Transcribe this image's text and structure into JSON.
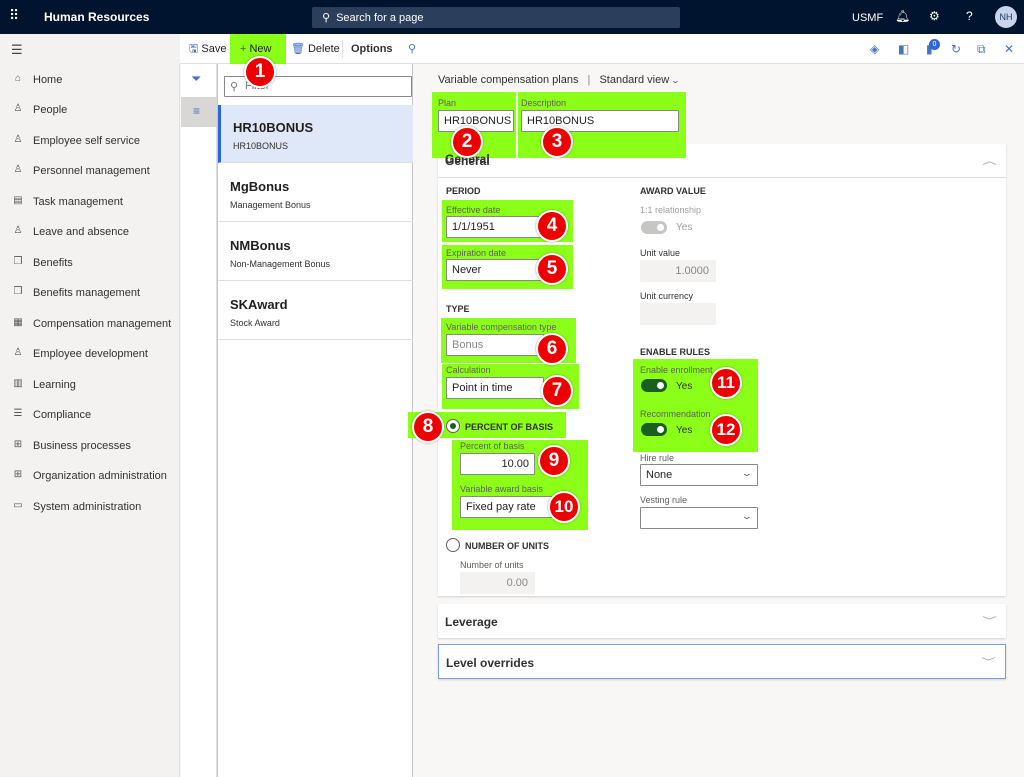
{
  "topbar": {
    "app_title": "Human Resources",
    "search_placeholder": "Search for a page",
    "company": "USMF",
    "user_initials": "NH",
    "icons": [
      "waffle-icon",
      "search-icon",
      "bell-icon",
      "gear-icon",
      "help-icon"
    ]
  },
  "actionbar": {
    "save": "Save",
    "new": "New",
    "delete": "Delete",
    "options": "Options",
    "attachments_count": "0"
  },
  "nav": {
    "items": [
      {
        "label": "Home",
        "icon": "⌂"
      },
      {
        "label": "People",
        "icon": "♙"
      },
      {
        "label": "Employee self service",
        "icon": "♙"
      },
      {
        "label": "Personnel management",
        "icon": "♙"
      },
      {
        "label": "Task management",
        "icon": "▤"
      },
      {
        "label": "Leave and absence",
        "icon": "♙"
      },
      {
        "label": "Benefits",
        "icon": "❒"
      },
      {
        "label": "Benefits management",
        "icon": "❒"
      },
      {
        "label": "Compensation management",
        "icon": "▦"
      },
      {
        "label": "Employee development",
        "icon": "♙"
      },
      {
        "label": "Learning",
        "icon": "▥"
      },
      {
        "label": "Compliance",
        "icon": "☰"
      },
      {
        "label": "Business processes",
        "icon": "⊞"
      },
      {
        "label": "Organization administration",
        "icon": "⊞"
      },
      {
        "label": "System administration",
        "icon": "▭"
      }
    ]
  },
  "list": {
    "filter_placeholder": "Filter",
    "records": [
      {
        "title": "HR10BONUS",
        "subtitle": "HR10BONUS",
        "selected": true
      },
      {
        "title": "MgBonus",
        "subtitle": "Management Bonus"
      },
      {
        "title": "NMBonus",
        "subtitle": "Non-Management Bonus"
      },
      {
        "title": "SKAward",
        "subtitle": "Stock Award"
      }
    ]
  },
  "detail": {
    "breadcrumb": "Variable compensation plans",
    "view": "Standard view",
    "plan_label": "Plan",
    "plan_value": "HR10BONUS",
    "description_label": "Description",
    "description_value": "HR10BONUS",
    "general": {
      "title": "General",
      "period_heading": "PERIOD",
      "effective_date_label": "Effective date",
      "effective_date": "1/1/1951",
      "expiration_date_label": "Expiration date",
      "expiration_date": "Never",
      "type_heading": "TYPE",
      "comp_type_label": "Variable compensation type",
      "comp_type": "Bonus",
      "calculation_label": "Calculation",
      "calculation": "Point in time",
      "percent_of_basis_option": "PERCENT OF BASIS",
      "percent_of_basis_label": "Percent of basis",
      "percent_of_basis": "10.00",
      "award_basis_label": "Variable award basis",
      "award_basis": "Fixed pay rate",
      "number_of_units_option": "NUMBER OF UNITS",
      "number_of_units_label": "Number of units",
      "number_of_units": "0.00",
      "selected_option": "PERCENT OF BASIS",
      "award_value_heading": "AWARD VALUE",
      "relationship_label": "1:1 relationship",
      "relationship_value": "Yes",
      "unit_value_label": "Unit value",
      "unit_value": "1.0000",
      "unit_currency_label": "Unit currency",
      "unit_currency": "",
      "enable_rules_heading": "ENABLE RULES",
      "enrollment_label": "Enable enrollment",
      "enrollment_value": "Yes",
      "recommendation_label": "Recommendation",
      "recommendation_value": "Yes",
      "hire_rule_label": "Hire rule",
      "hire_rule": "None",
      "vesting_rule_label": "Vesting rule",
      "vesting_rule": ""
    },
    "leverage_title": "Leverage",
    "level_overrides_title": "Level overrides"
  },
  "annotations": [
    "1",
    "2",
    "3",
    "4",
    "5",
    "6",
    "7",
    "8",
    "9",
    "10",
    "11",
    "12"
  ],
  "colors": {
    "topbar": "#00142f",
    "accent": "#2b66d8",
    "highlight": "#80ff00",
    "badge": "#ee0000",
    "toggle_on": "#1b5e20"
  }
}
